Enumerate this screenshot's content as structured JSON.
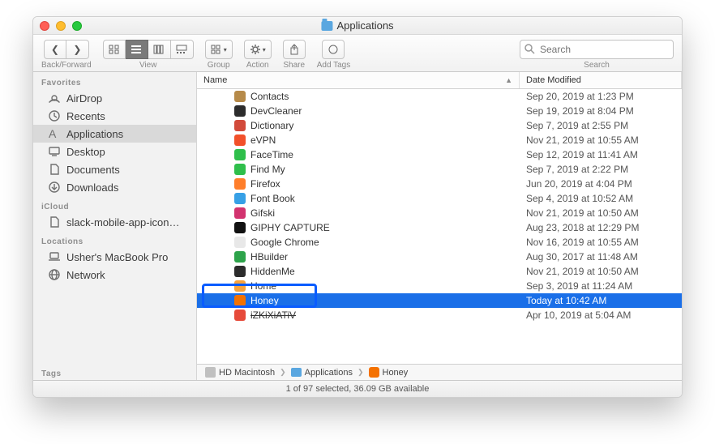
{
  "window": {
    "title": "Applications"
  },
  "toolbar": {
    "backforward_label": "Back/Forward",
    "view_label": "View",
    "group_label": "Group",
    "action_label": "Action",
    "share_label": "Share",
    "addtags_label": "Add Tags",
    "search_label": "Search",
    "search_placeholder": "Search"
  },
  "sidebar": {
    "favorites_label": "Favorites",
    "favorites": [
      {
        "icon": "airdrop",
        "label": "AirDrop"
      },
      {
        "icon": "recents",
        "label": "Recents"
      },
      {
        "icon": "apps",
        "label": "Applications"
      },
      {
        "icon": "desktop",
        "label": "Desktop"
      },
      {
        "icon": "docs",
        "label": "Documents"
      },
      {
        "icon": "downloads",
        "label": "Downloads"
      }
    ],
    "icloud_label": "iCloud",
    "icloud": [
      {
        "icon": "file",
        "label": "slack-mobile-app-icon…"
      }
    ],
    "locations_label": "Locations",
    "locations": [
      {
        "icon": "laptop",
        "label": "Usher's MacBook Pro"
      },
      {
        "icon": "globe",
        "label": "Network"
      }
    ],
    "tags_label": "Tags"
  },
  "columns": {
    "name": "Name",
    "date": "Date Modified"
  },
  "files": [
    {
      "name": "Contacts",
      "date": "Sep 20, 2019 at 1:23 PM",
      "color": "#b68a49"
    },
    {
      "name": "DevCleaner",
      "date": "Sep 19, 2019 at 8:04 PM",
      "color": "#2c2c2c"
    },
    {
      "name": "Dictionary",
      "date": "Sep 7, 2019 at 2:55 PM",
      "color": "#d24a3a"
    },
    {
      "name": "eVPN",
      "date": "Nov 21, 2019 at 10:55 AM",
      "color": "#f2502a"
    },
    {
      "name": "FaceTime",
      "date": "Sep 12, 2019 at 11:41 AM",
      "color": "#2fbf4b"
    },
    {
      "name": "Find My",
      "date": "Sep 7, 2019 at 2:22 PM",
      "color": "#2fbf4b"
    },
    {
      "name": "Firefox",
      "date": "Jun 20, 2019 at 4:04 PM",
      "color": "#ff7e2a"
    },
    {
      "name": "Font Book",
      "date": "Sep 4, 2019 at 10:52 AM",
      "color": "#37a0e6"
    },
    {
      "name": "Gifski",
      "date": "Nov 21, 2019 at 10:50 AM",
      "color": "#d2336f"
    },
    {
      "name": "GIPHY CAPTURE",
      "date": "Aug 23, 2018 at 12:29 PM",
      "color": "#111111"
    },
    {
      "name": "Google Chrome",
      "date": "Nov 16, 2019 at 10:55 AM",
      "color": "#e8e8e8"
    },
    {
      "name": "HBuilder",
      "date": "Aug 30, 2017 at 11:48 AM",
      "color": "#2da34a"
    },
    {
      "name": "HiddenMe",
      "date": "Nov 21, 2019 at 10:50 AM",
      "color": "#2c2c2c"
    },
    {
      "name": "Home",
      "date": "Sep 3, 2019 at 11:24 AM",
      "color": "#f7a23b"
    },
    {
      "name": "Honey",
      "date": "Today at 10:42 AM",
      "color": "#f47100",
      "selected": true
    },
    {
      "name": "iZKiXiATiV",
      "date": "Apr 10, 2019 at 5:04 AM",
      "color": "#e64a3a",
      "cut": true
    }
  ],
  "pathbar": {
    "disk": "HD Macintosh",
    "folder": "Applications",
    "item": "Honey"
  },
  "status": "1 of 97 selected, 36.09 GB available"
}
